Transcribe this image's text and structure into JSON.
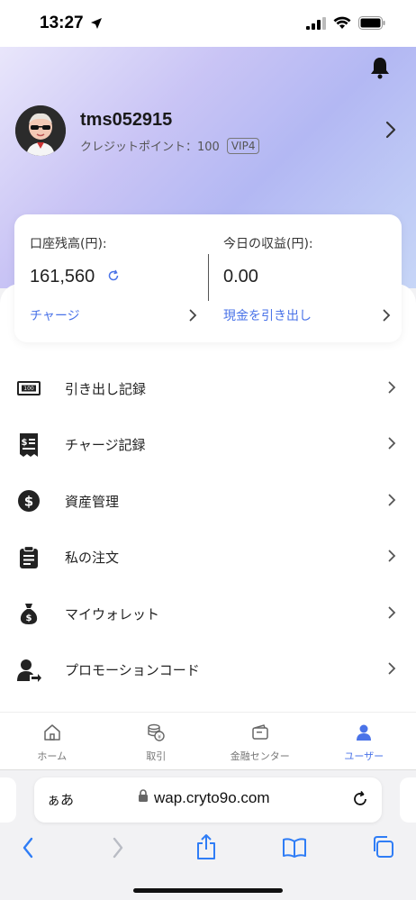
{
  "status": {
    "time": "13:27"
  },
  "profile": {
    "username": "tms052915",
    "credit_text": "クレジットポイント：100",
    "vip": "VIP4"
  },
  "balance_card": {
    "balance_label": "口座残高(円):",
    "balance_value": "161,560",
    "charge_link": "チャージ",
    "earnings_label": "今日の収益(円):",
    "earnings_value": "0.00",
    "withdraw_link": "現金を引き出し"
  },
  "menu": [
    {
      "label": "引き出し記録",
      "icon": "banknote-icon"
    },
    {
      "label": "チャージ記録",
      "icon": "receipt-icon"
    },
    {
      "label": "資産管理",
      "icon": "dollar-circle-icon"
    },
    {
      "label": "私の注文",
      "icon": "clipboard-icon"
    },
    {
      "label": "マイウォレット",
      "icon": "money-bag-icon"
    },
    {
      "label": "プロモーションコード",
      "icon": "user-share-icon"
    }
  ],
  "tabbar": [
    {
      "label": "ホーム",
      "icon": "home-icon"
    },
    {
      "label": "取引",
      "icon": "coin-stack-icon"
    },
    {
      "label": "金融センター",
      "icon": "wallet-icon"
    },
    {
      "label": "ユーザー",
      "icon": "user-icon",
      "active": true
    }
  ],
  "browser": {
    "aa": "ぁあ",
    "url": "wap.cryto9o.com"
  },
  "colors": {
    "accent": "#4a73e8",
    "header_gradient_start": "#e9e6fb",
    "header_gradient_end": "#c7d6f7"
  }
}
